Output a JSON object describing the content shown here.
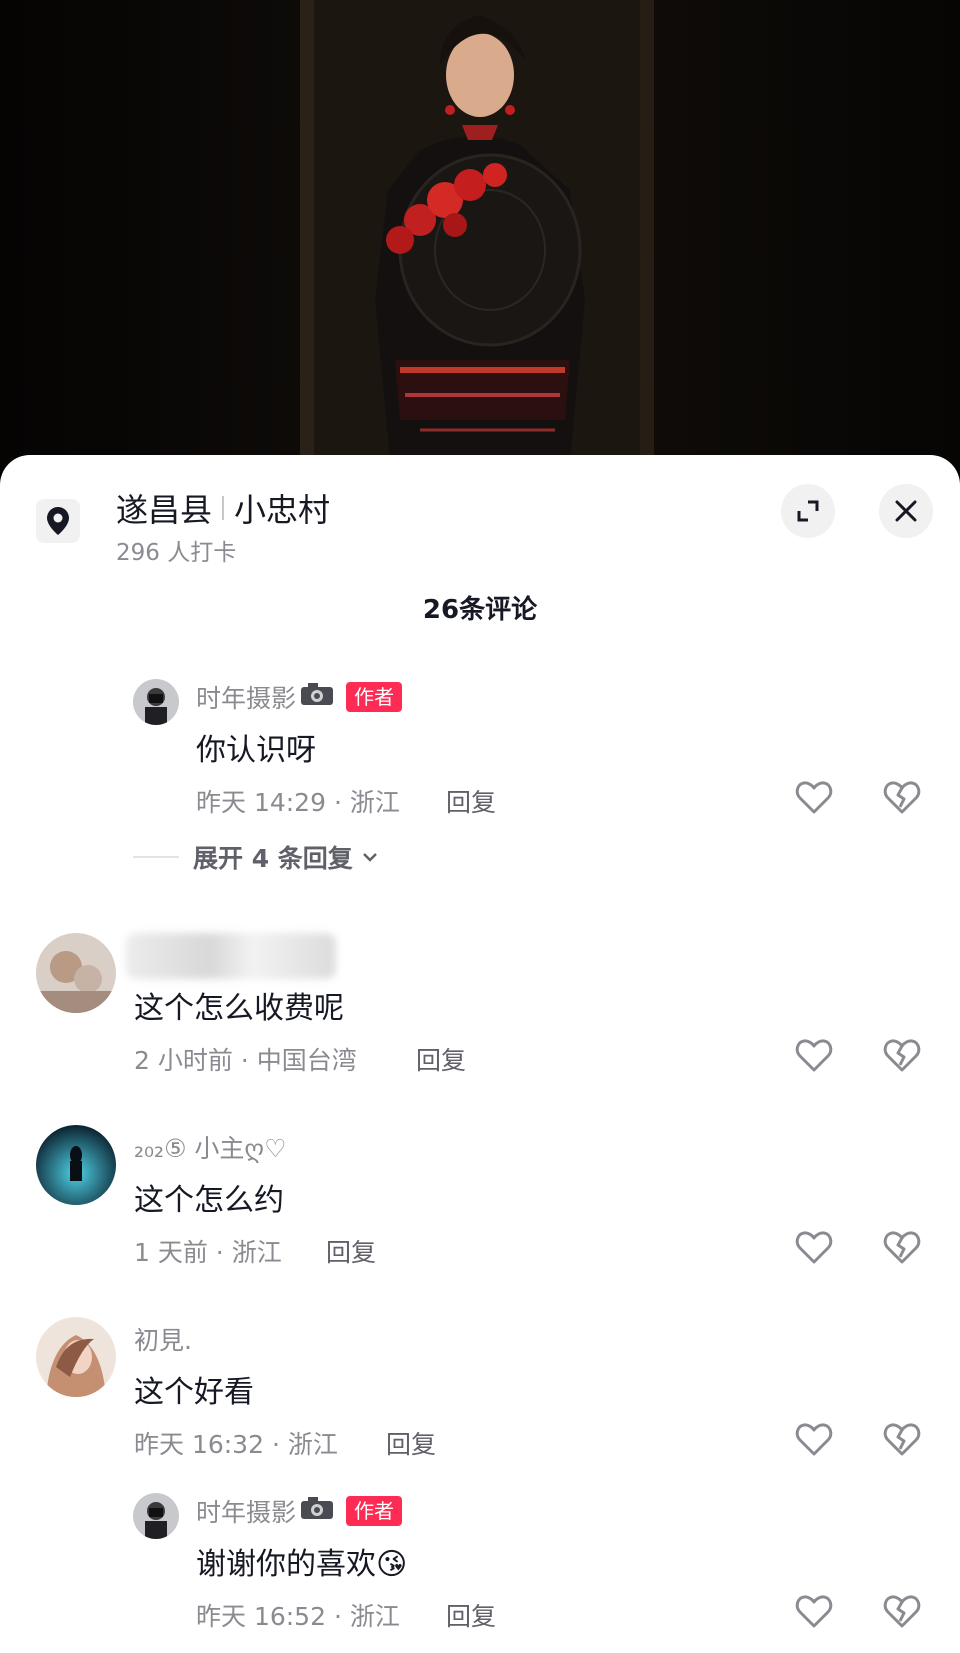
{
  "location": {
    "county": "遂昌县",
    "village": "小忠村",
    "checkins": "296 人打卡"
  },
  "header": {
    "comment_count": "26条评论"
  },
  "icons": {
    "location": "location-pin-icon",
    "expand": "expand-icon",
    "close": "close-icon",
    "like": "heart-outline-icon",
    "dislike": "broken-heart-icon",
    "camera": "camera-icon",
    "chevron": "chevron-down-icon"
  },
  "colors": {
    "author_tag": "#fe2c55",
    "meta_text": "#8a8b91",
    "body_text": "#161823"
  },
  "comments": [
    {
      "name": "时年摄影",
      "tag": "作者",
      "text": "你认识呀",
      "time": "昨天 14:29 · 浙江",
      "reply": "回复",
      "expand": "展开 4 条回复"
    },
    {
      "name": "",
      "text": "这个怎么收费呢",
      "time": "2 小时前 · 中国台湾",
      "reply": "回复"
    },
    {
      "name": "₂₀₂⑤ 小主ღ♡",
      "text": "这个怎么约",
      "time": "1 天前 · 浙江",
      "reply": "回复"
    },
    {
      "name": "初見.",
      "text": "这个好看",
      "time": "昨天 16:32 · 浙江",
      "reply": "回复"
    },
    {
      "name": "时年摄影",
      "tag": "作者",
      "text": "谢谢你的喜欢😘",
      "time": "昨天 16:52 · 浙江",
      "reply": "回复"
    }
  ]
}
